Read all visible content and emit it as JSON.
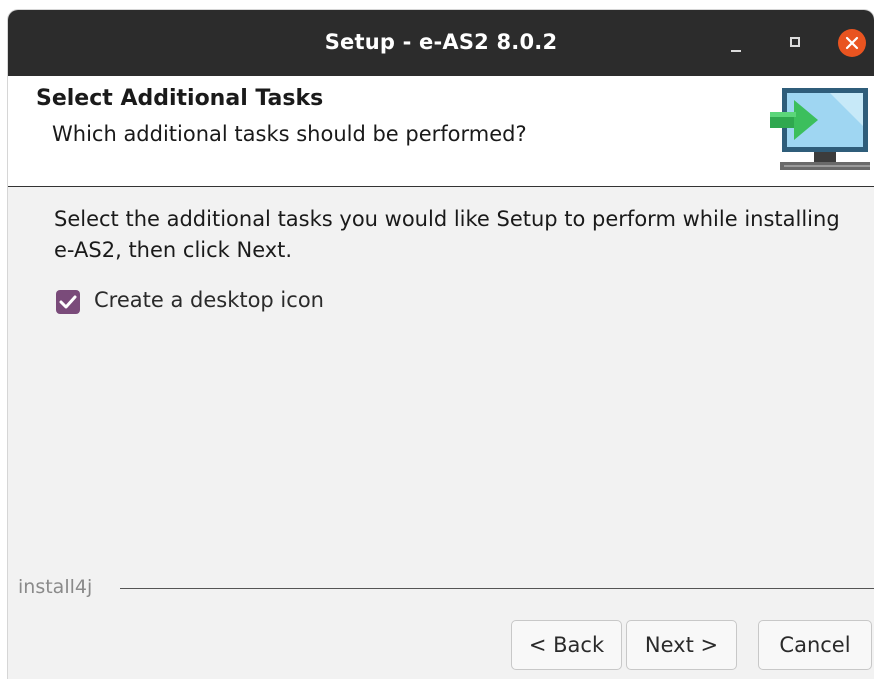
{
  "window": {
    "title": "Setup - e-AS2 8.0.2"
  },
  "header": {
    "title": "Select Additional Tasks",
    "subtitle": "Which additional tasks should be performed?",
    "icon": "install-monitor-arrow-icon"
  },
  "content": {
    "instructions": "Select the additional tasks you would like Setup to perform while installing e-AS2, then click Next.",
    "tasks": [
      {
        "label": "Create a desktop icon",
        "checked": true
      }
    ]
  },
  "footer": {
    "brand": "install4j",
    "back_label": "< Back",
    "next_label": "Next >",
    "cancel_label": "Cancel"
  },
  "colors": {
    "titlebar": "#2c2c2c",
    "close_button": "#e95420",
    "checkbox": "#7a4b7a",
    "window_bg": "#f2f2f2"
  }
}
